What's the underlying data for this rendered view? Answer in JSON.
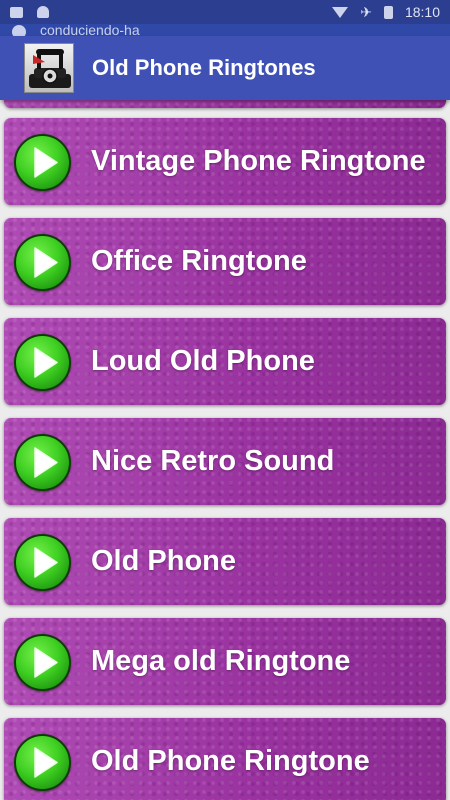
{
  "status_bar": {
    "time": "18:10",
    "icons": [
      "gallery-icon",
      "bell-icon",
      "wifi-icon",
      "airplane-icon",
      "battery-icon"
    ]
  },
  "browser": {
    "url": "conduciendo-ha"
  },
  "app_bar": {
    "title": "Old Phone Ringtones",
    "icon": "old-phone-icon",
    "color": "#3f51b5"
  },
  "list": {
    "card_color": "#a23aa6",
    "play_color": "#3fcf22",
    "items": [
      {
        "label": ""
      },
      {
        "label": "Vintage Phone Ringtone"
      },
      {
        "label": "Office Ringtone"
      },
      {
        "label": "Loud Old Phone"
      },
      {
        "label": "Nice Retro Sound"
      },
      {
        "label": "Old Phone"
      },
      {
        "label": "Mega old Ringtone"
      },
      {
        "label": "Old Phone Ringtone"
      }
    ]
  }
}
